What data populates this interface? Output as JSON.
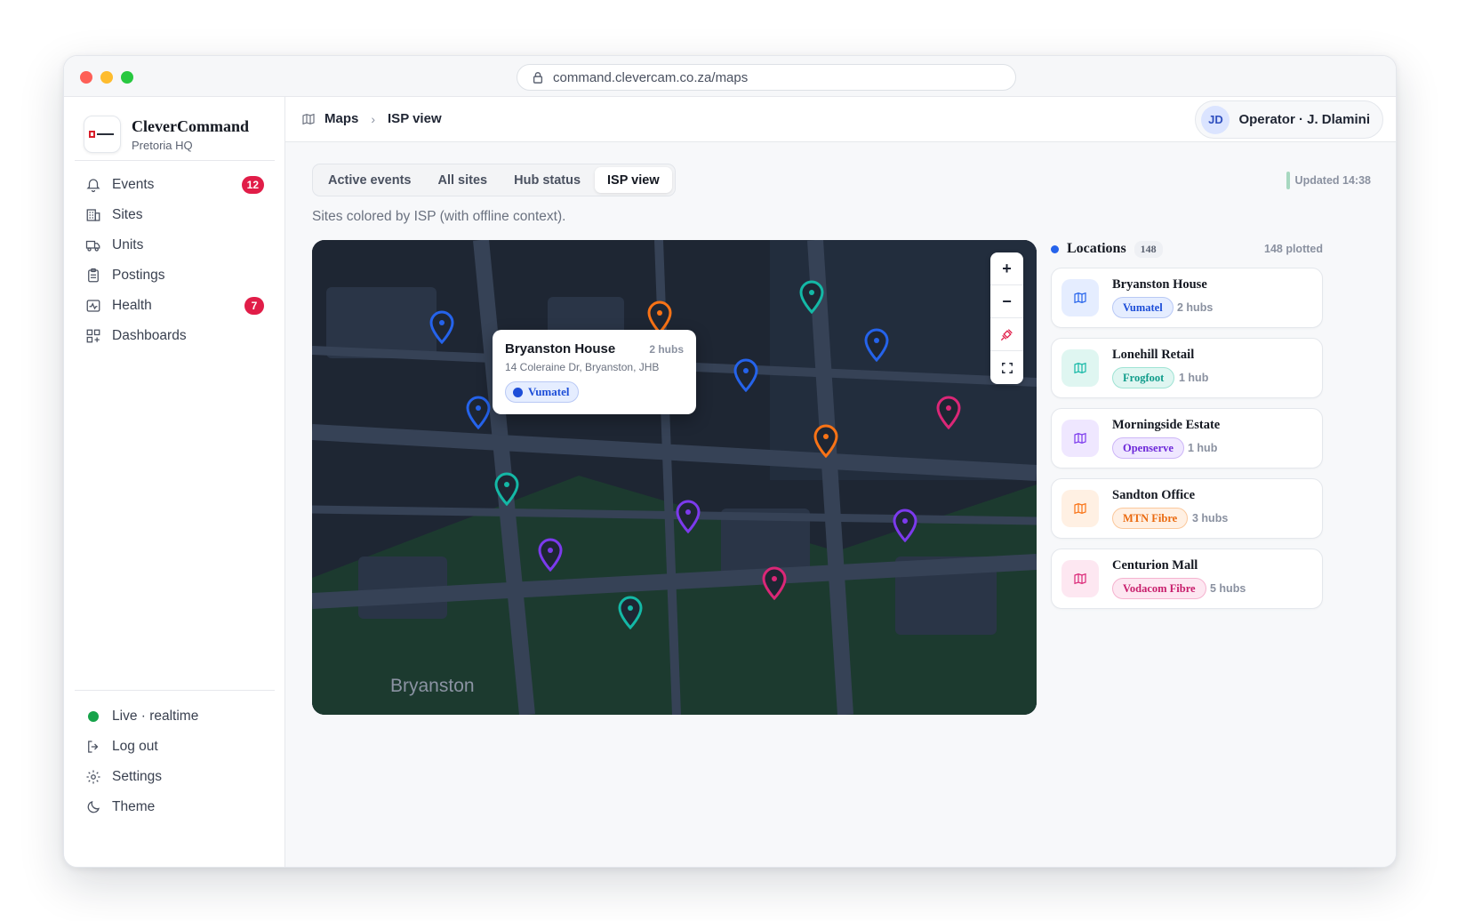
{
  "browser": {
    "url": "command.clevercam.co.za/maps"
  },
  "brand": {
    "title": "CleverCommand",
    "subtitle": "Pretoria HQ"
  },
  "nav": [
    {
      "label": "Events",
      "icon": "bell-icon",
      "badge": "12"
    },
    {
      "label": "Sites",
      "icon": "building-icon",
      "badge": ""
    },
    {
      "label": "Units",
      "icon": "truck-icon",
      "badge": ""
    },
    {
      "label": "Postings",
      "icon": "clipboard-icon",
      "badge": ""
    },
    {
      "label": "Health",
      "icon": "activity-icon",
      "badge": "7"
    },
    {
      "label": "Dashboards",
      "icon": "grid-plus-icon",
      "badge": ""
    }
  ],
  "bottom_nav": {
    "live": "Live · realtime",
    "logout": "Log out",
    "settings": "Settings",
    "theme": "Theme"
  },
  "breadcrumb": {
    "section": "Maps",
    "page": "ISP view"
  },
  "operator": {
    "initials": "JD",
    "label": "Operator · J. Dlamini"
  },
  "tabs": [
    "Active events",
    "All sites",
    "Hub status",
    "ISP view"
  ],
  "active_tab": "ISP view",
  "updated": "Updated 14:38",
  "subtitle": "Sites colored by ISP (with offline context).",
  "map": {
    "area_label": "Bryanston",
    "controls": {
      "zoom_in": "+",
      "zoom_out": "−"
    },
    "popup": {
      "title": "Bryanston House",
      "hubs": "2 hubs",
      "address": "14 Coleraine Dr, Bryanston, JHB",
      "isp": "Vumatel"
    }
  },
  "isp_colors": {
    "Vumatel": "#2563eb",
    "Frogfoot": "#14b8a6",
    "Openserve": "#7c3aed",
    "MTN Fibre": "#f97316",
    "Vodacom Fibre": "#db2777"
  },
  "locations": {
    "title": "Locations",
    "count": "148",
    "plotted": "148 plotted",
    "items": [
      {
        "name": "Bryanston House",
        "isp": "Vumatel",
        "hubs": "2 hubs"
      },
      {
        "name": "Lonehill Retail",
        "isp": "Frogfoot",
        "hubs": "1 hub"
      },
      {
        "name": "Morningside Estate",
        "isp": "Openserve",
        "hubs": "1 hub"
      },
      {
        "name": "Sandton Office",
        "isp": "MTN Fibre",
        "hubs": "3 hubs"
      },
      {
        "name": "Centurion Mall",
        "isp": "Vodacom Fibre",
        "hubs": "5 hubs"
      }
    ]
  }
}
